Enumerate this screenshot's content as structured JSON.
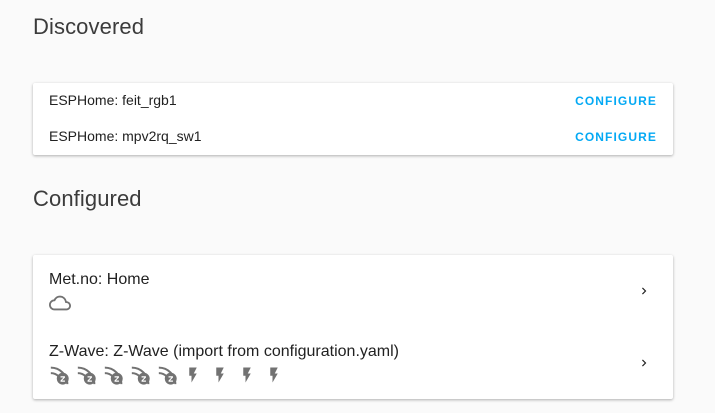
{
  "discovered": {
    "title": "Discovered",
    "items": [
      {
        "name": "ESPHome: feit_rgb1",
        "action": "CONFIGURE"
      },
      {
        "name": "ESPHome: mpv2rq_sw1",
        "action": "CONFIGURE"
      }
    ]
  },
  "configured": {
    "title": "Configured",
    "items": [
      {
        "name": "Met.no: Home",
        "icons": [
          "cloud-icon"
        ]
      },
      {
        "name": "Z-Wave: Z-Wave (import from configuration.yaml)",
        "icons": [
          "zwave-icon",
          "zwave-icon",
          "zwave-icon",
          "zwave-icon",
          "zwave-icon",
          "flash-icon",
          "flash-icon",
          "flash-icon",
          "flash-icon"
        ]
      }
    ]
  },
  "colors": {
    "accent": "#03a9f4",
    "icon": "#727272",
    "background": "#fafafa"
  }
}
